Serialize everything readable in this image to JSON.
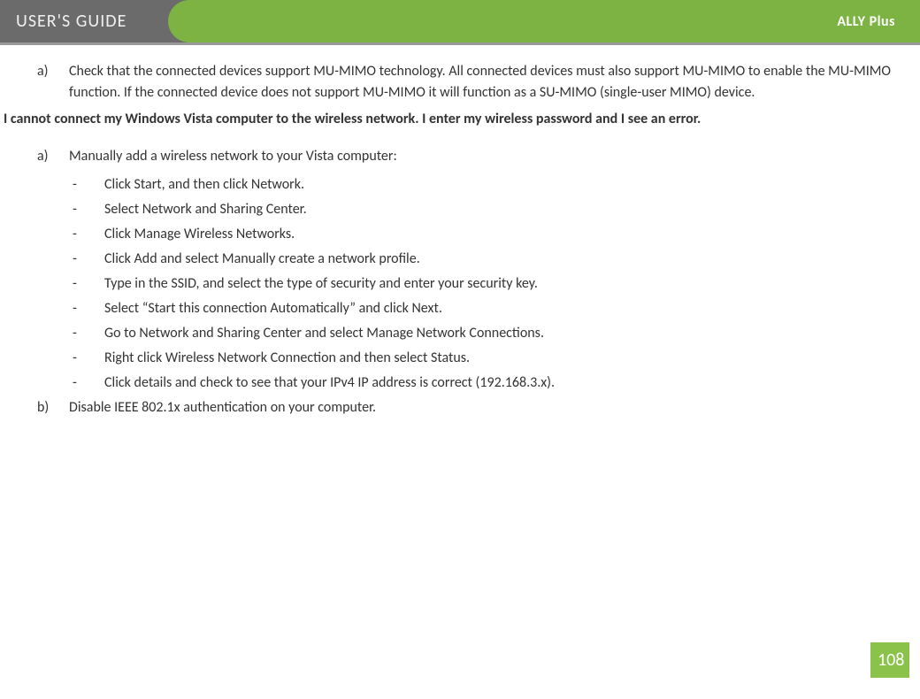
{
  "header": {
    "title": "USER'S GUIDE",
    "product": "ALLY Plus"
  },
  "section1": {
    "items": [
      {
        "marker": "a)",
        "text": "Check that the connected devices support MU-MIMO technology.  All connected devices must also support MU-MIMO to enable the MU-MIMO function.  If the connected device does not support MU-MIMO it will function as a SU-MIMO (single-user MIMO) device."
      }
    ]
  },
  "heading": "I cannot connect my Windows Vista computer to the wireless network.  I enter my wireless password and I see an error.",
  "section2": {
    "items": [
      {
        "marker": "a)",
        "text": "Manually add a wireless network to your Vista computer:",
        "sub": [
          "Click Start, and then click Network.",
          "Select Network and Sharing Center.",
          "Click Manage Wireless Networks.",
          "Click Add and select Manually create a network profile.",
          "Type in the SSID, and select the type of security and enter your security key.",
          "Select “Start this connection Automatically” and click Next.",
          "Go to Network and Sharing Center and select Manage Network Connections.",
          "Right click Wireless Network Connection and then select Status.",
          "Click details and check to see that your IPv4 IP address is correct (192.168.3.x)."
        ]
      },
      {
        "marker": "b)",
        "text": "Disable IEEE 802.1x authentication on your computer."
      }
    ]
  },
  "dashMarker": "-",
  "pageNumber": "108"
}
